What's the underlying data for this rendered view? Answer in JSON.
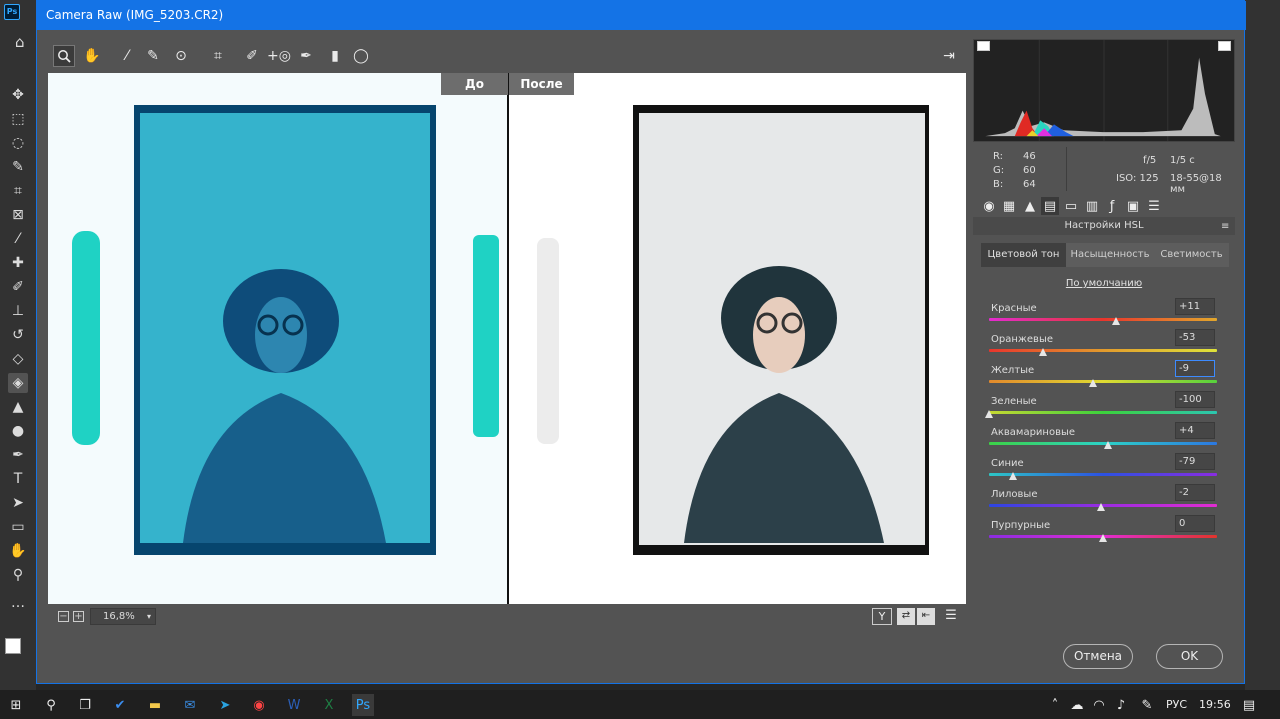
{
  "app": {
    "ps_logo": "Ps"
  },
  "dialog": {
    "title": "Camera Raw (IMG_5203.CR2)"
  },
  "toolbar": {
    "icons": [
      "zoom-icon",
      "hand-icon",
      "white-balance-icon",
      "color-sampler-icon",
      "target-adjust-icon",
      "crop-icon",
      "spot-removal-icon",
      "redeye-icon",
      "brush-icon",
      "graduated-filter-icon",
      "radial-filter-icon"
    ],
    "open_button_icon": "export-icon"
  },
  "preview": {
    "before_label": "До",
    "after_label": "После"
  },
  "zoom": {
    "value": "16,8%"
  },
  "info": {
    "r_label": "R:",
    "g_label": "G:",
    "b_label": "B:",
    "r": "46",
    "g": "60",
    "b": "64",
    "aperture": "f/5",
    "shutter": "1/5 с",
    "iso": "ISO: 125",
    "lens": "18-55@18 мм"
  },
  "panel": {
    "title": "Настройки HSL",
    "tabs": [
      "Цветовой тон",
      "Насыщенность",
      "Светимость"
    ],
    "active_tab": 0,
    "default_link": "По умолчанию",
    "sliders": [
      {
        "name": "Красные",
        "value": "+11",
        "num": 11
      },
      {
        "name": "Оранжевые",
        "value": "-53",
        "num": -53
      },
      {
        "name": "Желтые",
        "value": "-9",
        "num": -9
      },
      {
        "name": "Зеленые",
        "value": "-100",
        "num": -100
      },
      {
        "name": "Аквамариновые",
        "value": "+4",
        "num": 4
      },
      {
        "name": "Синие",
        "value": "-79",
        "num": -79
      },
      {
        "name": "Лиловые",
        "value": "-2",
        "num": -2
      },
      {
        "name": "Пурпурные",
        "value": "0",
        "num": 0
      }
    ]
  },
  "buttons": {
    "cancel": "Отмена",
    "ok": "OK"
  },
  "taskbar": {
    "lang": "РУС",
    "time": "19:56"
  }
}
